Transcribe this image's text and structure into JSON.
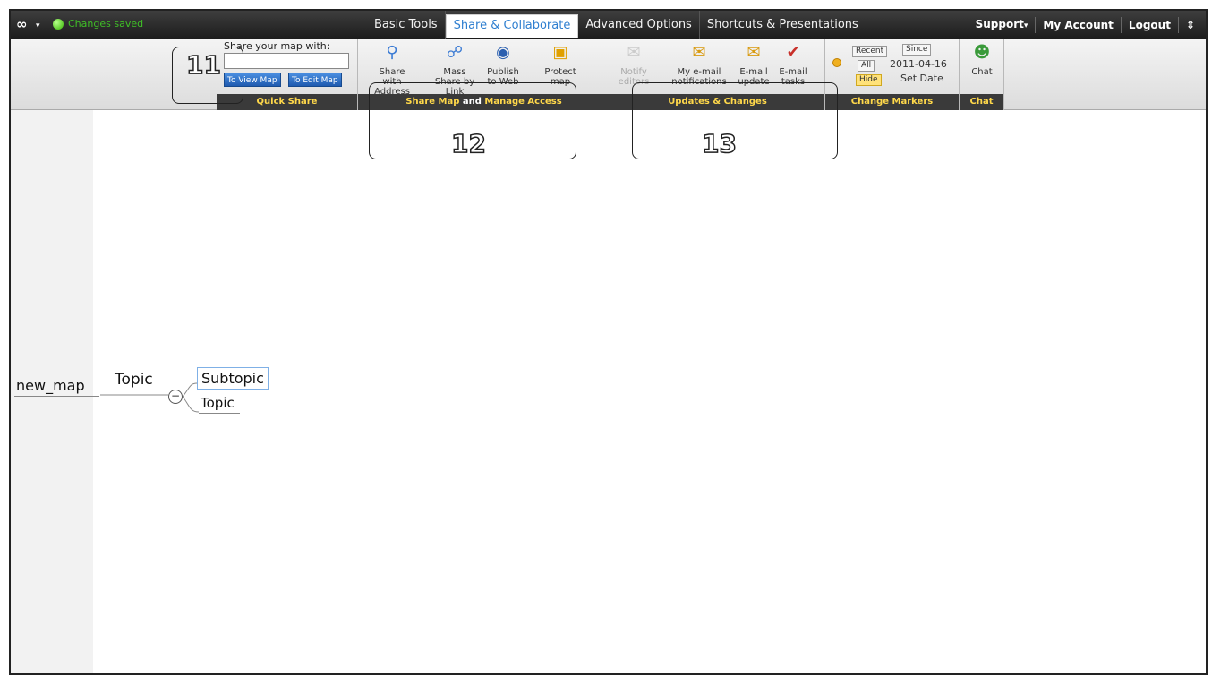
{
  "topbar": {
    "logo": "∞",
    "status": "Changes saved",
    "tabs": [
      "Basic Tools",
      "Share & Collaborate",
      "Advanced Options",
      "Shortcuts & Presentations"
    ],
    "active_tab": "Share & Collaborate",
    "right": {
      "support": "Support",
      "account": "My Account",
      "logout": "Logout",
      "menu": "⇕"
    }
  },
  "ribbon": {
    "quick_share": {
      "title": "Share your map with:",
      "view_btn": "To View Map",
      "edit_btn": "To Edit Map",
      "label": "Quick Share"
    },
    "share_map": {
      "label_a": "Share Map",
      "label_and": " and ",
      "label_b": "Manage Access",
      "tools": [
        "Share with Address Book",
        "Mass Share by Link",
        "Publish to Web",
        "Protect map"
      ]
    },
    "updates": {
      "label": "Updates & Changes",
      "disabled_tool": "Notify editors",
      "tools": [
        "My e-mail notifications",
        "E-mail update",
        "E-mail tasks"
      ]
    },
    "change_markers": {
      "label": "Change Markers",
      "recent": "Recent",
      "since": "Since",
      "all": "All",
      "date": "2011-04-16",
      "hide": "Hide",
      "set_date": "Set Date"
    },
    "chat": {
      "tool": "Chat",
      "label": "Chat"
    }
  },
  "map": {
    "root": "new_map",
    "topic1": "Topic",
    "subtopic": "Subtopic",
    "topic2": "Topic",
    "collapse": "−"
  },
  "callouts": [
    "11",
    "12",
    "13"
  ],
  "colors": {
    "accent": "#2f7fd0",
    "label_yellow": "#ffd84a",
    "status_green": "#3fbf26"
  }
}
